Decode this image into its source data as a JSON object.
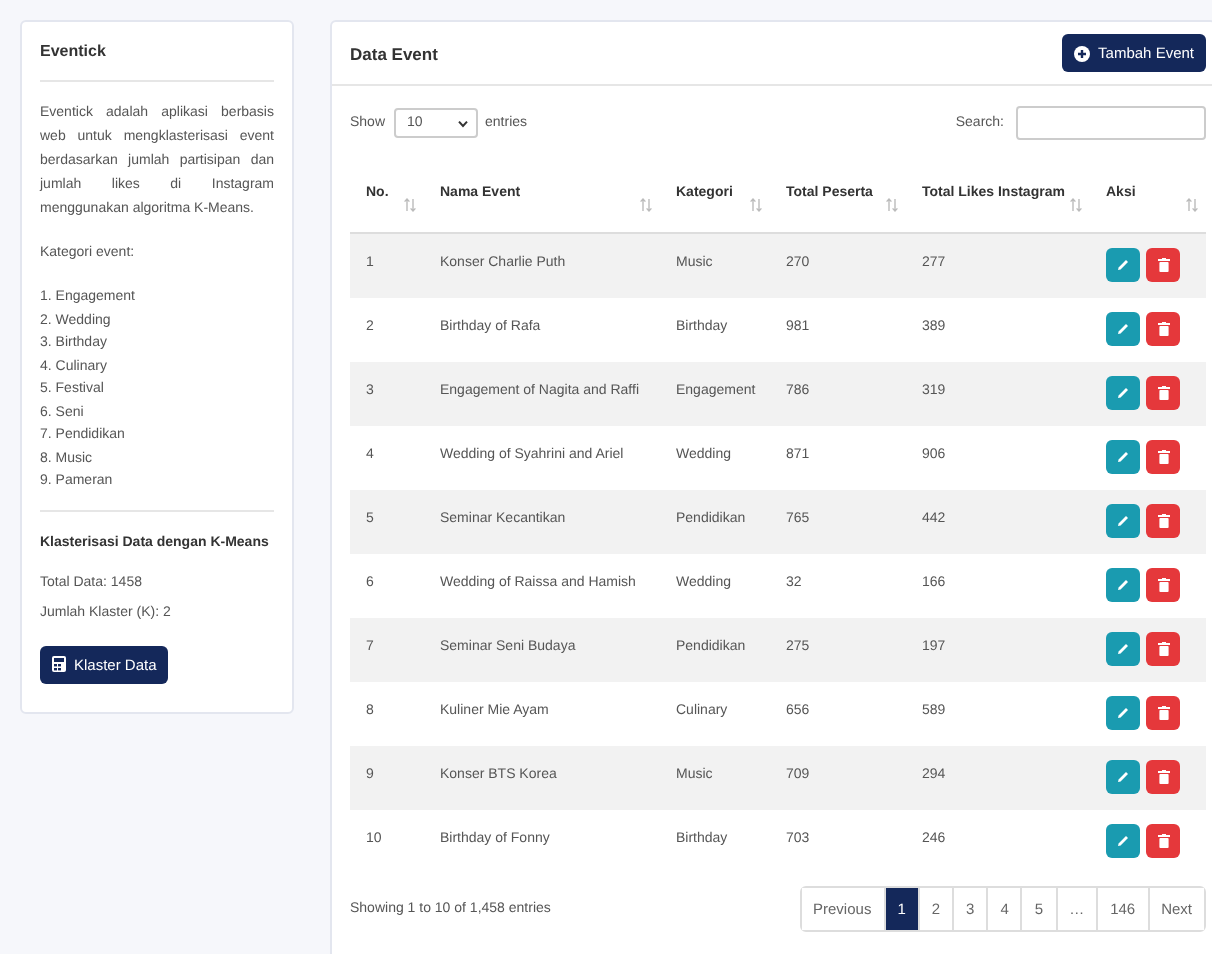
{
  "sidebar": {
    "title": "Eventick",
    "description": "Eventick adalah aplikasi berbasis web untuk mengklasterisasi event berdasarkan jumlah partisipan dan jumlah likes di Instagram menggunakan algoritma K-Means.",
    "categories_label": "Kategori event:",
    "categories": [
      "1. Engagement",
      "2. Wedding",
      "3. Birthday",
      "4. Culinary",
      "5. Festival",
      "6. Seni",
      "7. Pendidikan",
      "8. Music",
      "9. Pameran"
    ],
    "section_title": "Klasterisasi Data dengan K-Means",
    "total_data": "Total Data: 1458",
    "cluster_count": "Jumlah Klaster (K): 2",
    "button": "Klaster Data"
  },
  "main": {
    "title": "Data Event",
    "add_button": "Tambah Event",
    "show_label": "Show",
    "page_size": "10",
    "entries_label": "entries",
    "search_label": "Search:",
    "columns": [
      "No.",
      "Nama Event",
      "Kategori",
      "Total Peserta",
      "Total Likes Instagram",
      "Aksi"
    ],
    "rows": [
      {
        "no": "1",
        "name": "Konser Charlie Puth",
        "category": "Music",
        "participants": "270",
        "likes": "277"
      },
      {
        "no": "2",
        "name": "Birthday of Rafa",
        "category": "Birthday",
        "participants": "981",
        "likes": "389"
      },
      {
        "no": "3",
        "name": "Engagement of Nagita and Raffi",
        "category": "Engagement",
        "participants": "786",
        "likes": "319"
      },
      {
        "no": "4",
        "name": "Wedding of Syahrini and Ariel",
        "category": "Wedding",
        "participants": "871",
        "likes": "906"
      },
      {
        "no": "5",
        "name": "Seminar Kecantikan",
        "category": "Pendidikan",
        "participants": "765",
        "likes": "442"
      },
      {
        "no": "6",
        "name": "Wedding of Raissa and Hamish",
        "category": "Wedding",
        "participants": "32",
        "likes": "166"
      },
      {
        "no": "7",
        "name": "Seminar Seni Budaya",
        "category": "Pendidikan",
        "participants": "275",
        "likes": "197"
      },
      {
        "no": "8",
        "name": "Kuliner Mie Ayam",
        "category": "Culinary",
        "participants": "656",
        "likes": "589"
      },
      {
        "no": "9",
        "name": "Konser BTS Korea",
        "category": "Music",
        "participants": "709",
        "likes": "294"
      },
      {
        "no": "10",
        "name": "Birthday of Fonny",
        "category": "Birthday",
        "participants": "703",
        "likes": "246"
      }
    ],
    "info": "Showing 1 to 10 of 1,458 entries",
    "pagination": [
      {
        "label": "Previous",
        "selected": false
      },
      {
        "label": "1",
        "selected": true
      },
      {
        "label": "2",
        "selected": false
      },
      {
        "label": "3",
        "selected": false
      },
      {
        "label": "4",
        "selected": false
      },
      {
        "label": "5",
        "selected": false
      },
      {
        "label": "…",
        "selected": false
      },
      {
        "label": "146",
        "selected": false
      },
      {
        "label": "Next",
        "selected": false
      }
    ]
  }
}
